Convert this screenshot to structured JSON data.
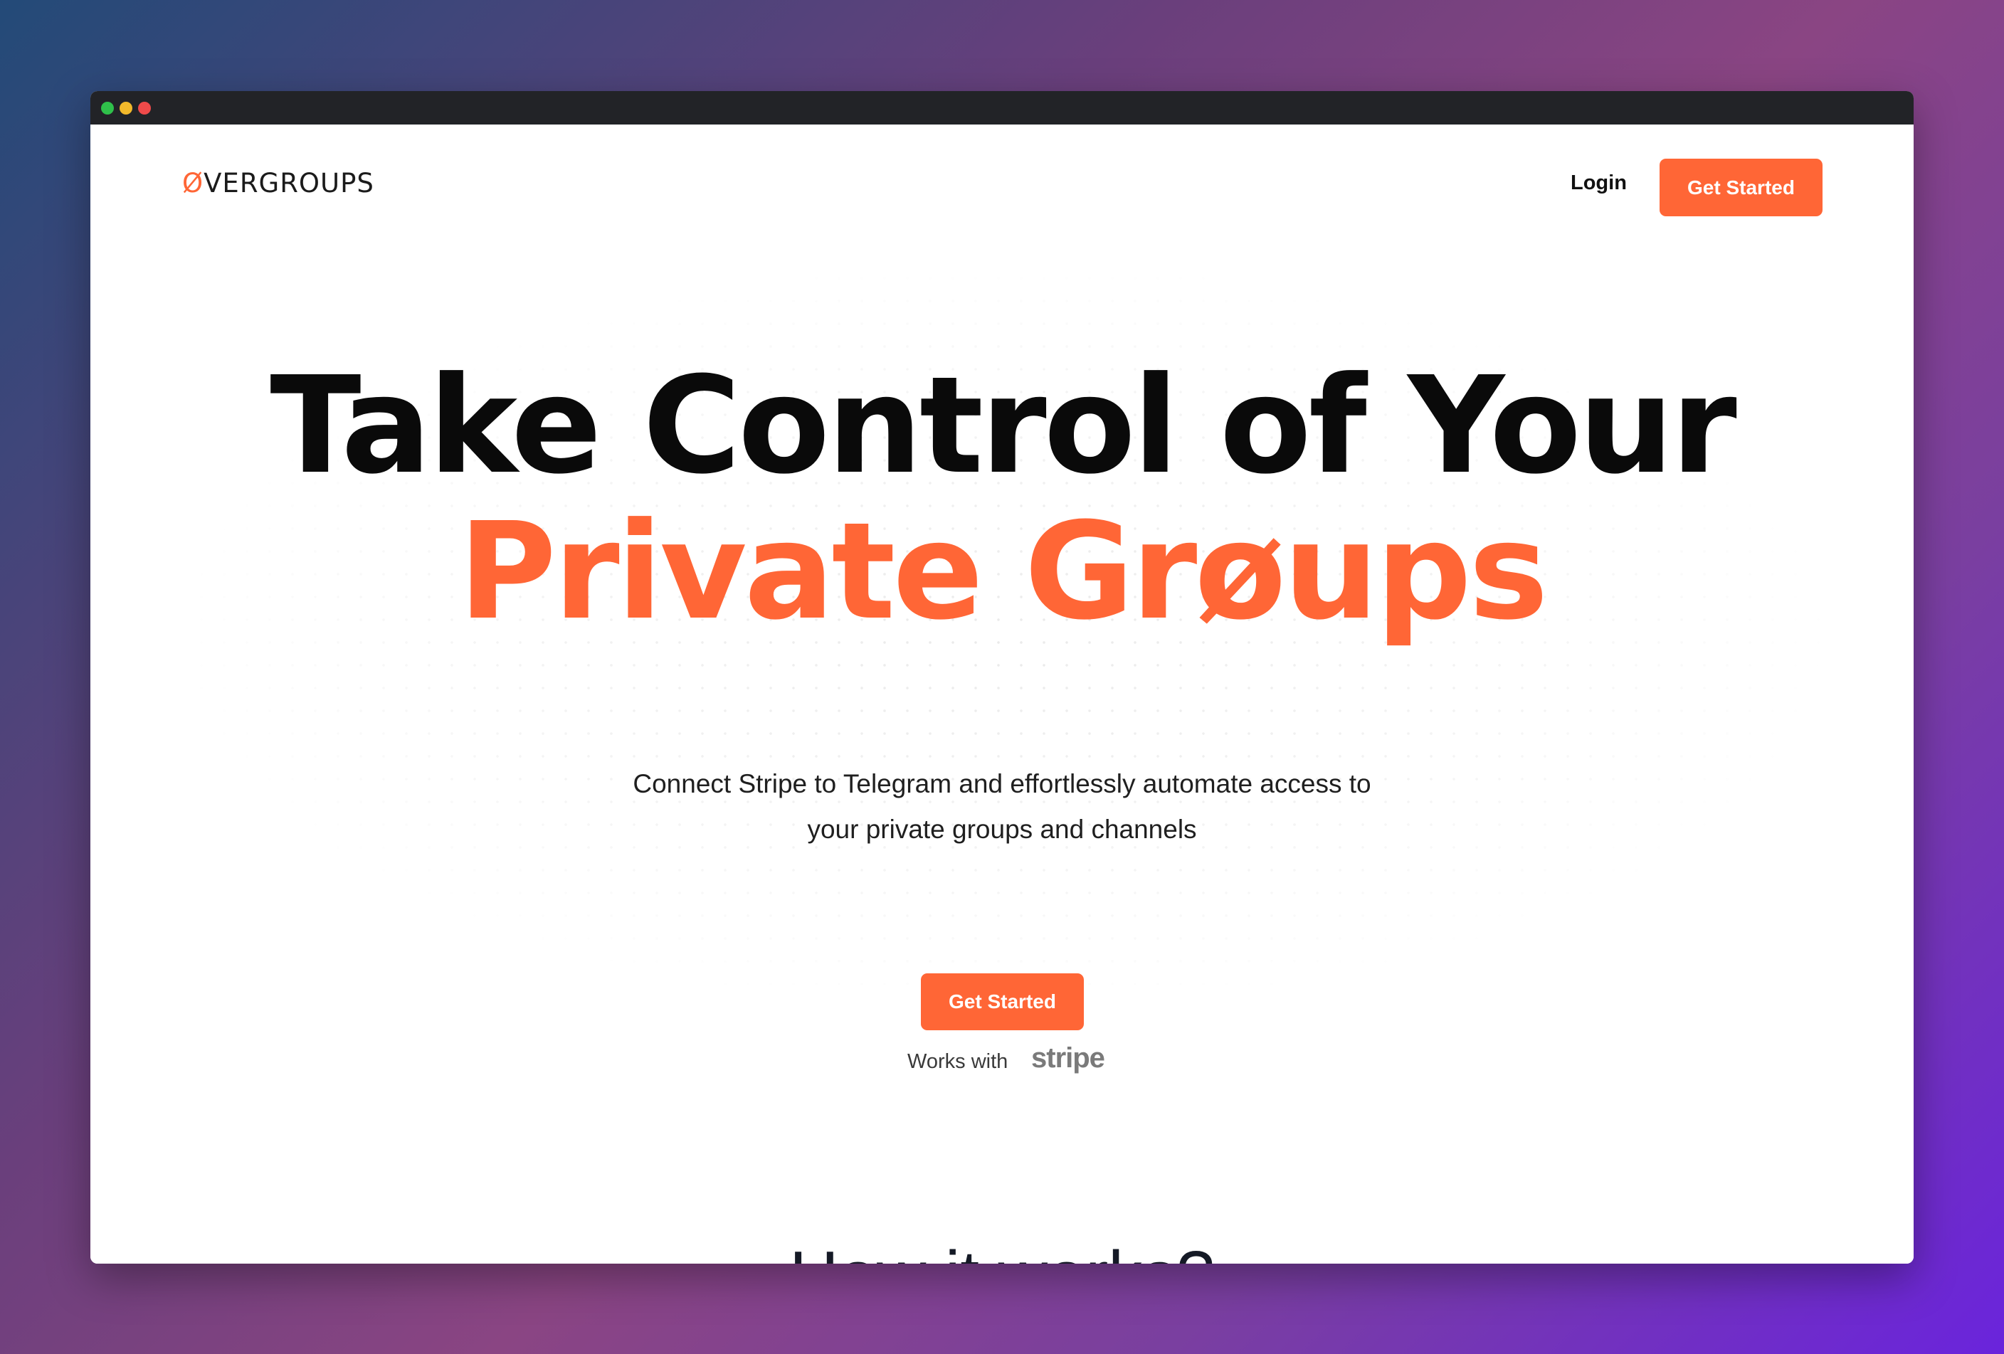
{
  "window": {
    "controls": [
      "green",
      "yellow",
      "red"
    ]
  },
  "nav": {
    "logo_mark": "Ø",
    "logo_text": "VERGROUPS",
    "login_label": "Login",
    "cta_label": "Get Started"
  },
  "hero": {
    "headline_line1": "Take Control of Your",
    "headline_line2": "Private Grøups",
    "subtitle_line1": "Connect Stripe to Telegram and effortlessly automate access to",
    "subtitle_line2": "your private groups and channels",
    "cta_label": "Get Started",
    "works_with_label": "Works with",
    "partner_logo_text": "stripe"
  },
  "section": {
    "how_title": "How it works?"
  },
  "colors": {
    "accent": "#ff6636",
    "headline": "#0a0a0a",
    "titlebar": "#222327"
  }
}
